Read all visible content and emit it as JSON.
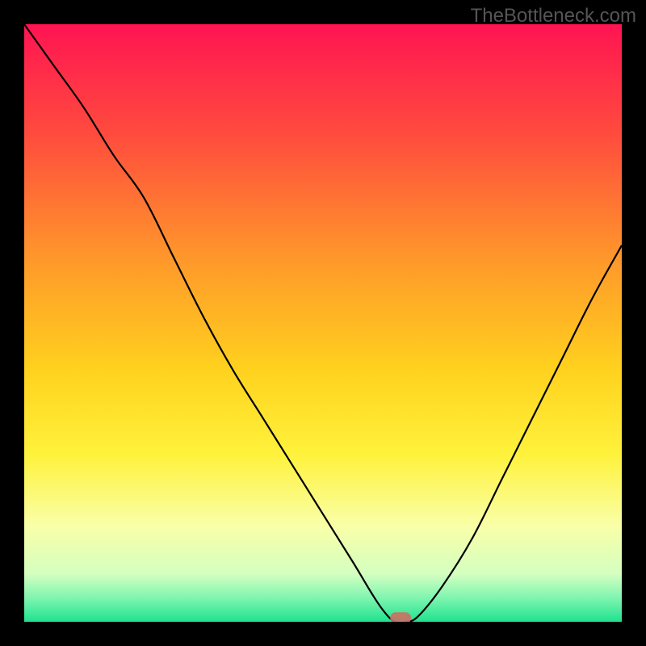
{
  "watermark": "TheBottleneck.com",
  "chart_data": {
    "type": "line",
    "title": "",
    "xlabel": "",
    "ylabel": "",
    "xlim": [
      0,
      100
    ],
    "ylim": [
      0,
      100
    ],
    "x": [
      0,
      5,
      10,
      15,
      20,
      25,
      30,
      35,
      40,
      45,
      50,
      55,
      58,
      60,
      62,
      64,
      66,
      70,
      75,
      80,
      85,
      90,
      95,
      100
    ],
    "y": [
      100,
      93,
      86,
      78,
      71,
      61,
      51,
      42,
      34,
      26,
      18,
      10,
      5,
      2,
      0,
      0,
      1,
      6,
      14,
      24,
      34,
      44,
      54,
      63
    ],
    "marker": {
      "x": 63,
      "y": 0.5
    },
    "background": {
      "type": "vertical_gradient",
      "stops": [
        {
          "pos": 0.0,
          "color": "#ff1452"
        },
        {
          "pos": 0.18,
          "color": "#ff4a3e"
        },
        {
          "pos": 0.4,
          "color": "#ff9a2a"
        },
        {
          "pos": 0.58,
          "color": "#ffd21e"
        },
        {
          "pos": 0.72,
          "color": "#fff23c"
        },
        {
          "pos": 0.84,
          "color": "#f9ffa8"
        },
        {
          "pos": 0.92,
          "color": "#d4ffc0"
        },
        {
          "pos": 0.96,
          "color": "#7ff5b0"
        },
        {
          "pos": 1.0,
          "color": "#1ee28f"
        }
      ]
    }
  }
}
